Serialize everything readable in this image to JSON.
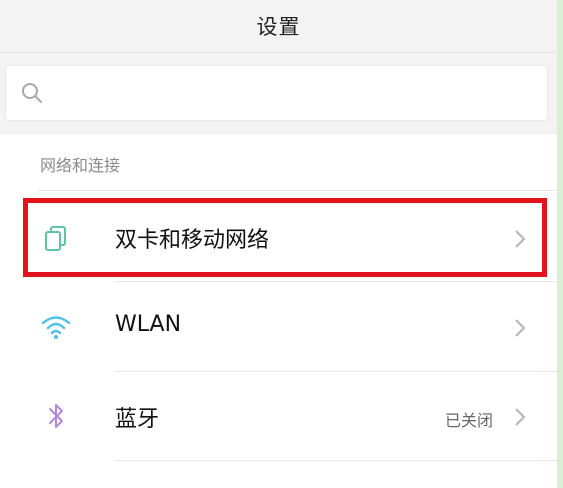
{
  "header": {
    "title": "设置"
  },
  "search": {
    "placeholder": "",
    "value": ""
  },
  "section": {
    "title": "网络和连接"
  },
  "rows": [
    {
      "label": "双卡和移动网络",
      "status": "",
      "icon": "dual-sim-icon"
    },
    {
      "label": "WLAN",
      "status": "",
      "icon": "wifi-icon"
    },
    {
      "label": "蓝牙",
      "status": "已关闭",
      "icon": "bluetooth-icon"
    }
  ],
  "colors": {
    "highlight": "#e3141c",
    "icon_green": "#5ec4a3",
    "icon_wifi": "#4fc0e8",
    "icon_bluetooth": "#b08ad6"
  }
}
